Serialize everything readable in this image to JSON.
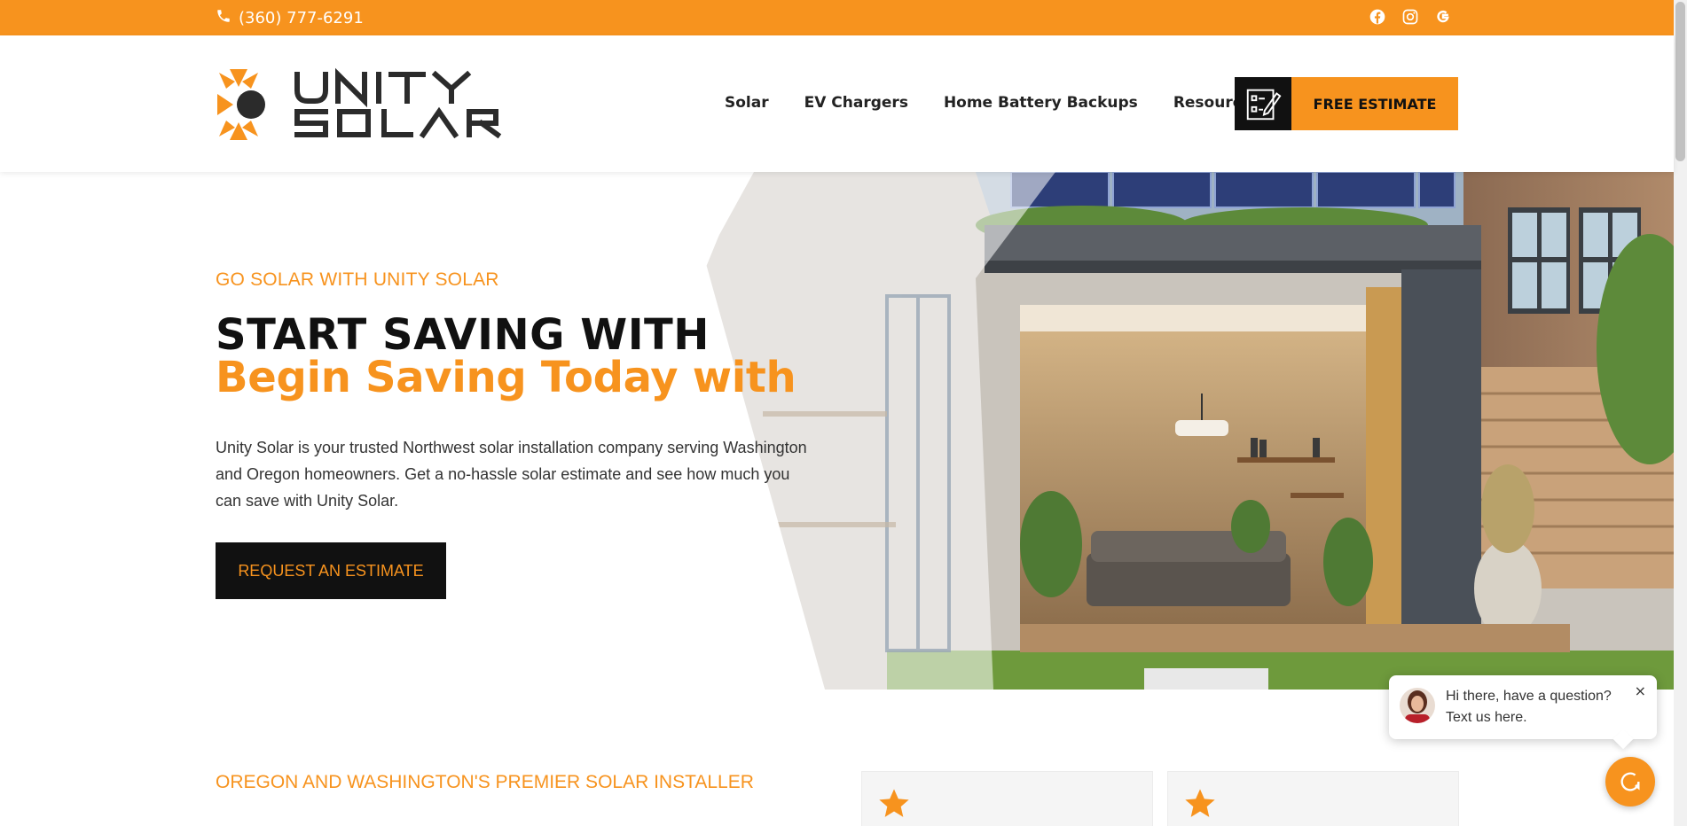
{
  "colors": {
    "accent": "#f7931e",
    "dark": "#111111",
    "text": "#333333"
  },
  "topbar": {
    "phone": "(360) 777-6291",
    "phone_icon": "phone-icon",
    "socials": [
      "facebook-icon",
      "instagram-icon",
      "google-icon"
    ]
  },
  "header": {
    "logo_text": "UNITY SOLAR",
    "nav": [
      "Solar",
      "EV Chargers",
      "Home Battery Backups",
      "Resources"
    ],
    "cta_label": "FREE ESTIMATE",
    "cta_icon": "checklist-pen-icon"
  },
  "hero": {
    "eyebrow": "GO SOLAR WITH UNITY SOLAR",
    "title_line1": "START SAVING WITH",
    "title_line2": "Begin Saving Today with",
    "description": "Unity Solar is your trusted Northwest solar installation company serving Washington and Oregon homeowners. Get a no-hassle solar estimate and see how much you can save with Unity Solar.",
    "button": "REQUEST AN ESTIMATE"
  },
  "section": {
    "eyebrow": "OREGON AND WASHINGTON'S PREMIER SOLAR INSTALLER",
    "card_icons": [
      "star-icon",
      "star-icon"
    ]
  },
  "chat": {
    "line1": "Hi there, have a question?",
    "line2": "Text us here.",
    "close": "×",
    "launcher_icon": "chat-icon"
  }
}
